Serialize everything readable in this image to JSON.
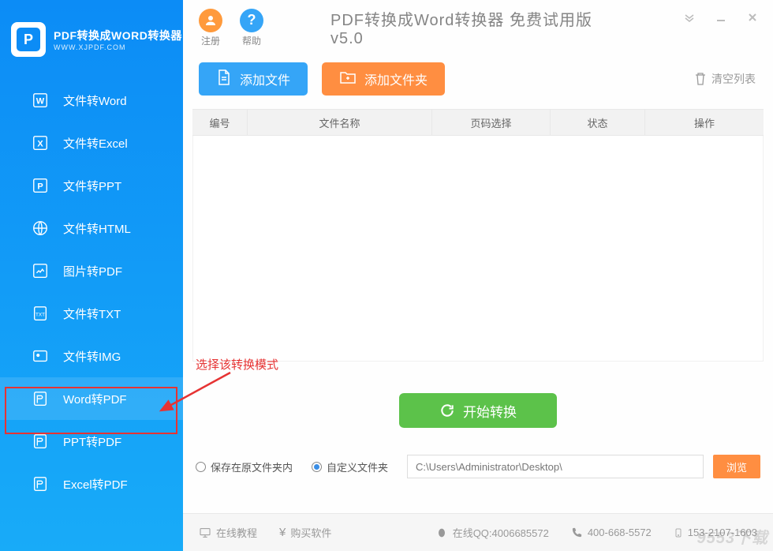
{
  "logo": {
    "title": "PDF转换成WORD转换器",
    "subtitle": "WWW.XJPDF.COM",
    "letter": "P"
  },
  "sidebar": {
    "items": [
      {
        "label": "文件转Word"
      },
      {
        "label": "文件转Excel"
      },
      {
        "label": "文件转PPT"
      },
      {
        "label": "文件转HTML"
      },
      {
        "label": "图片转PDF"
      },
      {
        "label": "文件转TXT"
      },
      {
        "label": "文件转IMG"
      },
      {
        "label": "Word转PDF"
      },
      {
        "label": "PPT转PDF"
      },
      {
        "label": "Excel转PDF"
      }
    ]
  },
  "header": {
    "register": "注册",
    "help": "帮助",
    "title": "PDF转换成Word转换器 免费试用版 v5.0"
  },
  "toolbar": {
    "add_file": "添加文件",
    "add_folder": "添加文件夹",
    "clear": "清空列表"
  },
  "table": {
    "cols": [
      "编号",
      "文件名称",
      "页码选择",
      "状态",
      "操作"
    ]
  },
  "annotation": {
    "text": "选择该转换模式"
  },
  "convert": {
    "label": "开始转换"
  },
  "save": {
    "opt1": "保存在原文件夹内",
    "opt2": "自定义文件夹",
    "path": "C:\\Users\\Administrator\\Desktop\\",
    "browse": "浏览"
  },
  "footer": {
    "tutorial": "在线教程",
    "buy": "购买软件",
    "qq": "在线QQ:4006685572",
    "tel": "400-668-5572",
    "tel2": "153-2107-1603"
  },
  "watermark": "9553下载"
}
